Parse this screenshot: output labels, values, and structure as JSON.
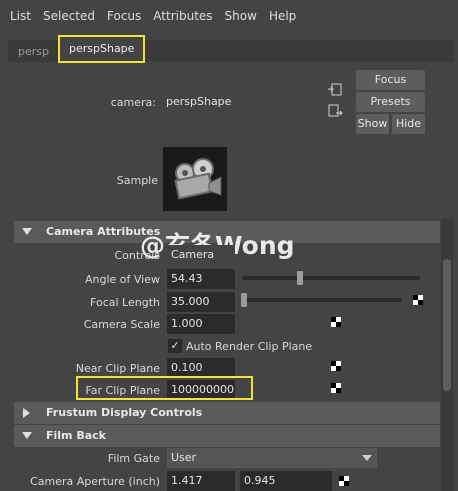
{
  "menubar": {
    "items": [
      "List",
      "Selected",
      "Focus",
      "Attributes",
      "Show",
      "Help"
    ]
  },
  "tabs": [
    {
      "label": "persp"
    },
    {
      "label": "perspShape"
    }
  ],
  "camera": {
    "label": "camera:",
    "value": "perspShape"
  },
  "buttons": {
    "focus": "Focus",
    "presets": "Presets",
    "show": "Show",
    "hide": "Hide"
  },
  "sample": {
    "label": "Sample"
  },
  "watermark": "@玄冬Wong",
  "sections": {
    "camera_attributes": "Camera Attributes",
    "frustum_display_controls": "Frustum Display Controls",
    "film_back": "Film Back"
  },
  "attributes": {
    "controls": {
      "label": "Controls",
      "value": "Camera"
    },
    "angle_of_view": {
      "label": "Angle of View",
      "value": "54.43",
      "slider": 0.22
    },
    "focal_length": {
      "label": "Focal Length",
      "value": "35.000",
      "slider": 0.0
    },
    "camera_scale": {
      "label": "Camera Scale",
      "value": "1.000"
    },
    "auto_render_clip_plane": {
      "label": "Auto Render Clip Plane",
      "checked": "✓"
    },
    "near_clip_plane": {
      "label": "Near Clip Plane",
      "value": "0.100"
    },
    "far_clip_plane": {
      "label": "Far Clip Plane",
      "value": "100000000.0"
    },
    "film_gate": {
      "label": "Film Gate",
      "value": "User"
    },
    "camera_aperture": {
      "label": "Camera Aperture (inch)",
      "value1": "1.417",
      "value2": "0.945"
    }
  },
  "colors": {
    "highlight": "#f2e23a",
    "background": "#444444",
    "field": "#2b2b2b",
    "section_header": "#5a5a5a"
  }
}
